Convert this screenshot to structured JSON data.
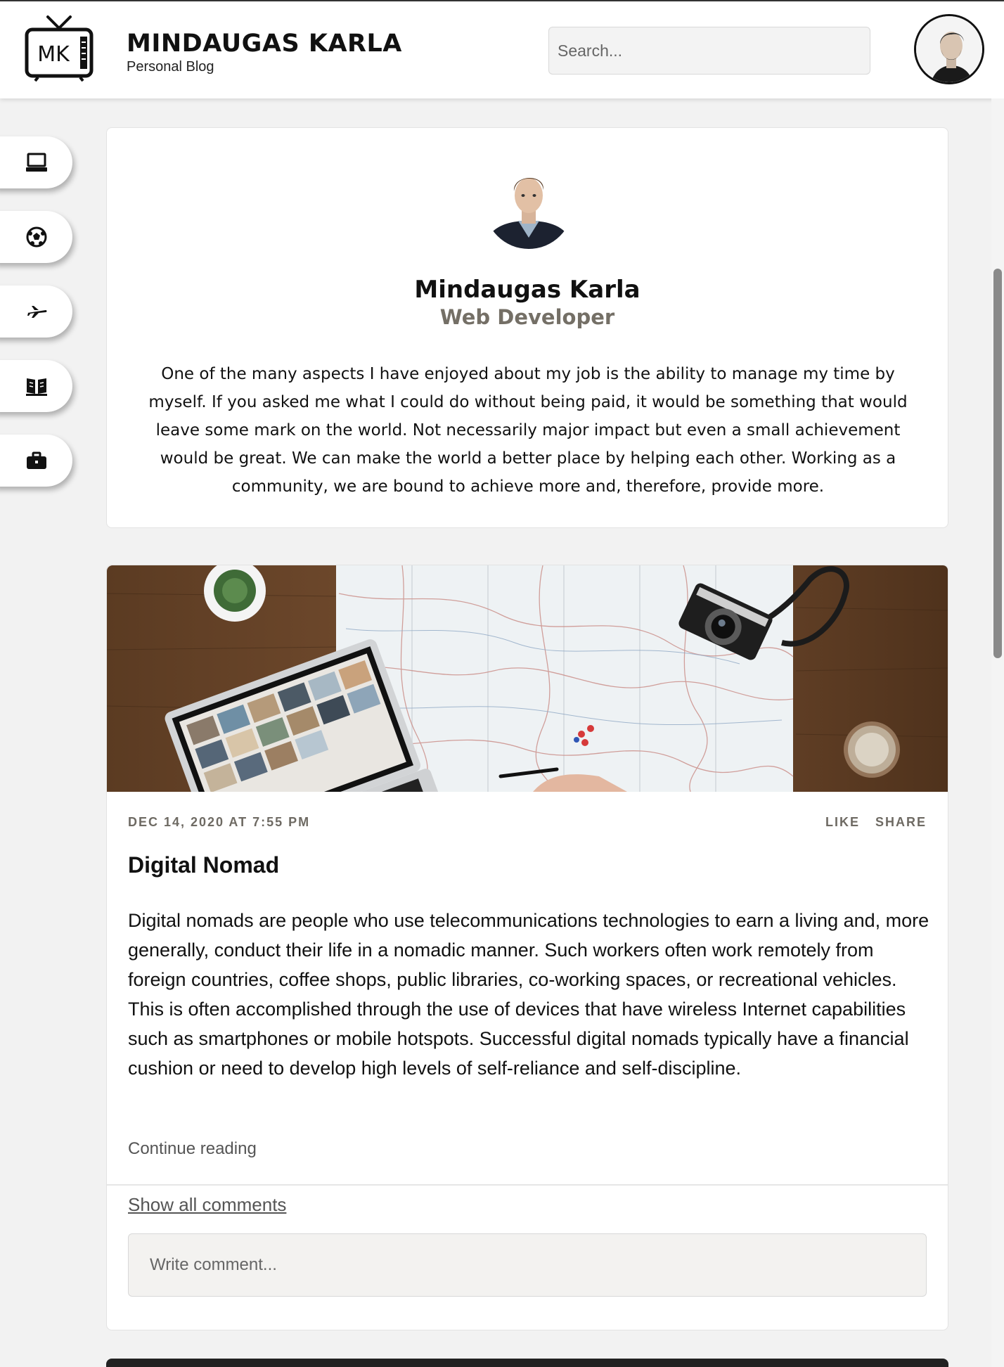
{
  "header": {
    "logo_text": "MK",
    "title": "MINDAUGAS KARLA",
    "subtitle": "Personal Blog",
    "search_placeholder": "Search...",
    "avatar_icon": "user-avatar"
  },
  "sidebar": {
    "items": [
      {
        "icon": "laptop-icon"
      },
      {
        "icon": "soccer-ball-icon"
      },
      {
        "icon": "airplane-icon"
      },
      {
        "icon": "book-icon"
      },
      {
        "icon": "briefcase-icon"
      }
    ]
  },
  "profile": {
    "name": "Mindaugas Karla",
    "role": "Web Developer",
    "bio": "One of the many aspects I have enjoyed about my job is the ability to manage my time by myself. If you asked me what I could do without being paid, it would be something that would leave some mark on the world. Not necessarily major impact but even a small achievement would be great. We can make the world a better place by helping each other. Working as a community, we are bound to achieve more and, therefore, provide more."
  },
  "post": {
    "date": "DEC 14, 2020 AT 7:55 PM",
    "like_label": "LIKE",
    "share_label": "SHARE",
    "title": "Digital Nomad",
    "body": "Digital nomads are people who use telecommunications technologies to earn a living and, more generally, conduct their life in a nomadic manner. Such workers often work remotely from foreign countries, coffee shops, public libraries, co-working spaces, or recreational vehicles. This is often accomplished through the use of devices that have wireless Internet capabilities such as smartphones or mobile hotspots. Successful digital nomads typically have a financial cushion or need to develop high levels of self-reliance and self-discipline.",
    "continue_label": "Continue reading",
    "show_comments_label": "Show all comments",
    "comment_placeholder": "Write comment..."
  },
  "colors": {
    "accent_muted": "#746f66",
    "background": "#f2f2f2",
    "card": "#ffffff"
  }
}
